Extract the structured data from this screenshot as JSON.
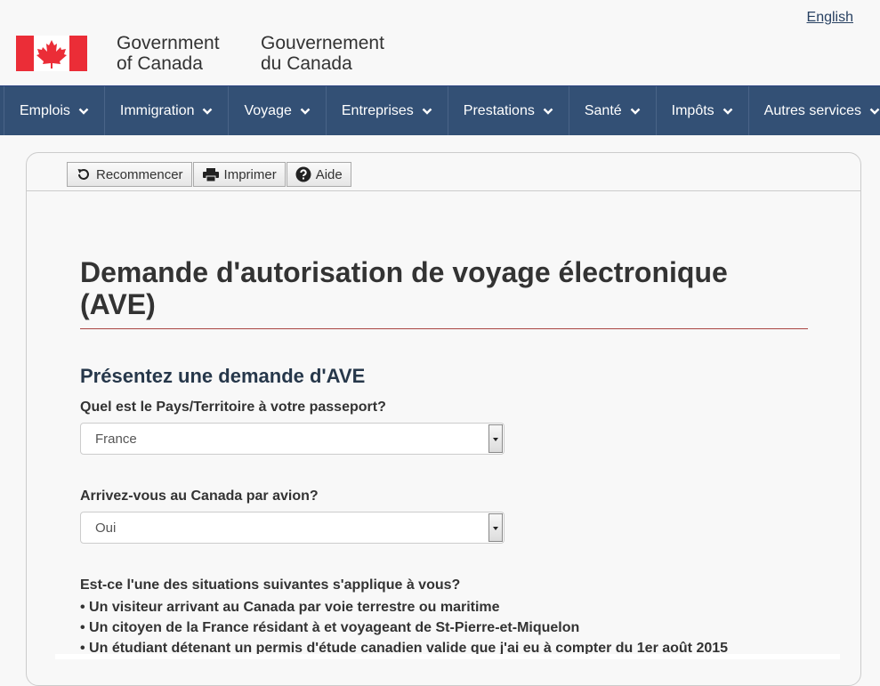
{
  "header": {
    "lang_link": "English",
    "gov_en_line1": "Government",
    "gov_en_line2": "of Canada",
    "gov_fr_line1": "Gouvernement",
    "gov_fr_line2": "du Canada",
    "flag_colors": {
      "red": "#eb2d37",
      "white": "#ffffff"
    }
  },
  "nav": {
    "bg": "#335075",
    "items": [
      {
        "label": "Emplois"
      },
      {
        "label": "Immigration"
      },
      {
        "label": "Voyage"
      },
      {
        "label": "Entreprises"
      },
      {
        "label": "Prestations"
      },
      {
        "label": "Santé"
      },
      {
        "label": "Impôts"
      },
      {
        "label": "Autres services"
      }
    ]
  },
  "toolbar": {
    "restart": "Recommencer",
    "print": "Imprimer",
    "help": "Aide"
  },
  "main": {
    "title": "Demande d'autorisation de voyage électronique (AVE)",
    "subtitle": "Présentez une demande d'AVE",
    "q1": "Quel est le Pays/Territoire à votre passeport?",
    "q1_value": "France",
    "q2": "Arrivez-vous au Canada par avion?",
    "q2_value": "Oui",
    "q3": "Est-ce l'une des situations suivantes s'applique à vous?",
    "bullets": [
      "• Un visiteur arrivant au Canada par voie terrestre ou maritime",
      "• Un citoyen de la France résidant à et voyageant de St-Pierre-et-Miquelon",
      "• Un étudiant détenant un permis d'étude canadien valide que j'ai eu à compter du 1er août 2015"
    ]
  }
}
